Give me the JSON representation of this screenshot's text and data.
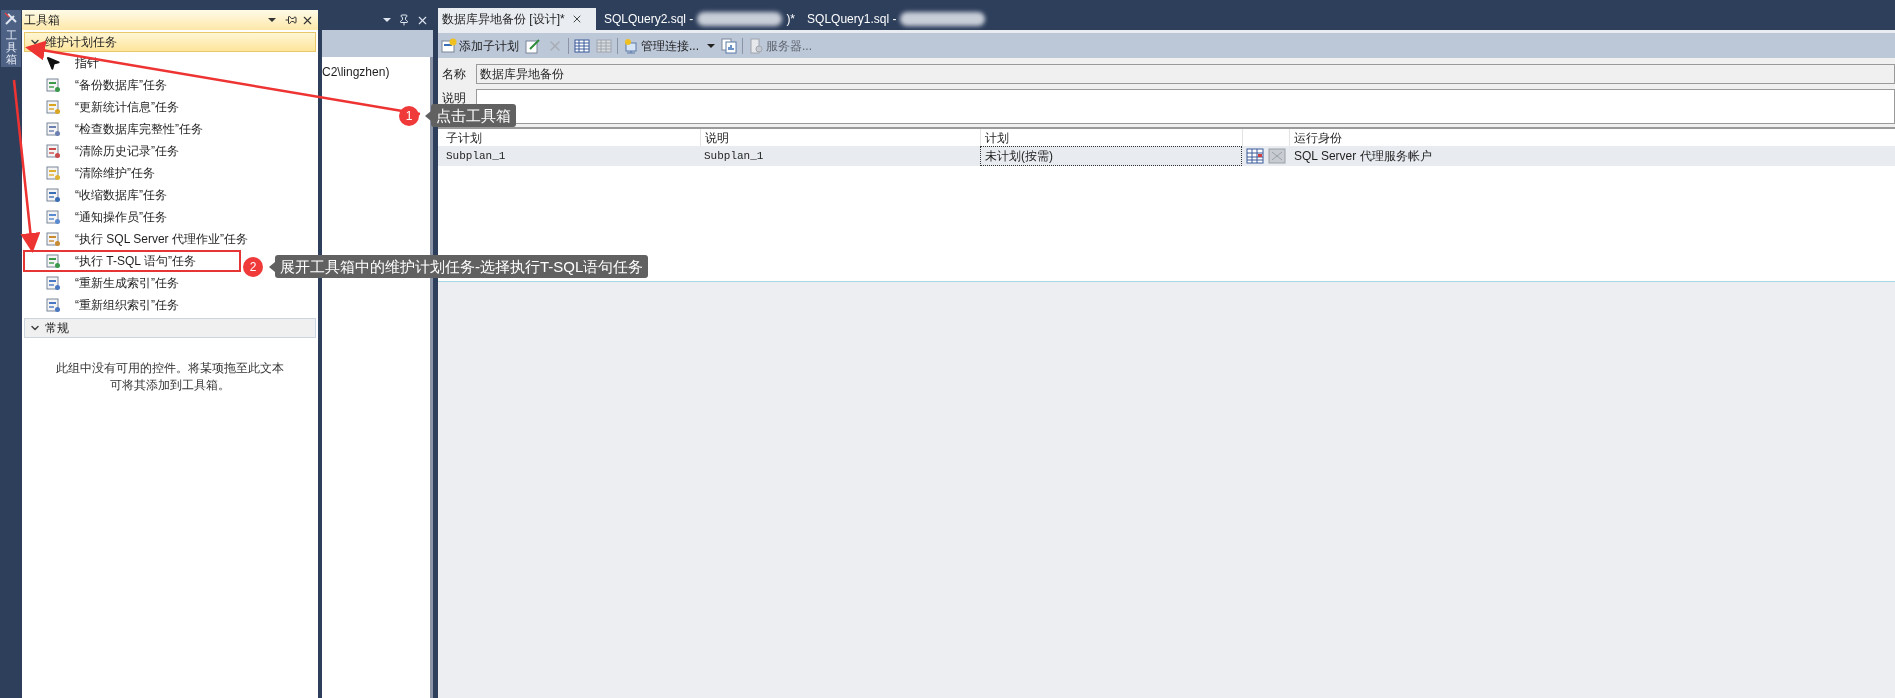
{
  "side_strip": {
    "label": "工具箱"
  },
  "toolbox": {
    "title": "工具箱",
    "groups": [
      {
        "title": "维护计划任务",
        "expanded": true,
        "active": true,
        "items": [
          {
            "label": "指针",
            "kind": "pointer",
            "highlighted": false
          },
          {
            "label": "“备份数据库”任务",
            "kind": "task",
            "highlighted": false
          },
          {
            "label": "“更新统计信息”任务",
            "kind": "task",
            "highlighted": false
          },
          {
            "label": "“检查数据库完整性”任务",
            "kind": "task",
            "highlighted": false
          },
          {
            "label": "“清除历史记录”任务",
            "kind": "task",
            "highlighted": false
          },
          {
            "label": "“清除维护”任务",
            "kind": "task",
            "highlighted": false
          },
          {
            "label": "“收缩数据库”任务",
            "kind": "task",
            "highlighted": false
          },
          {
            "label": "“通知操作员”任务",
            "kind": "task",
            "highlighted": false
          },
          {
            "label": "“执行 SQL Server 代理作业”任务",
            "kind": "task",
            "highlighted": false
          },
          {
            "label": "“执行 T-SQL 语句”任务",
            "kind": "task",
            "highlighted": true
          },
          {
            "label": "“重新生成索引”任务",
            "kind": "task",
            "highlighted": false
          },
          {
            "label": "“重新组织索引”任务",
            "kind": "task",
            "highlighted": false
          }
        ]
      },
      {
        "title": "常规",
        "expanded": true,
        "active": false,
        "empty_message": "此组中没有可用的控件。将某项拖至此文本可将其添加到工具箱。"
      }
    ]
  },
  "middle_panel": {
    "text": "C2\\lingzhen)"
  },
  "tabs": [
    {
      "label": "数据库异地备份 [设计]*",
      "selected": true,
      "redacted": false
    },
    {
      "label": "SQLQuery2.sql -",
      "selected": false,
      "redacted": true,
      "suffix": ")*"
    },
    {
      "label": "SQLQuery1.sql -",
      "selected": false,
      "redacted": true
    }
  ],
  "toolbar": [
    {
      "kind": "add",
      "label": "添加子计划",
      "disabled": false
    },
    {
      "kind": "edit",
      "disabled": false
    },
    {
      "kind": "delete",
      "disabled": true
    },
    {
      "kind": "separator"
    },
    {
      "kind": "grid",
      "disabled": false
    },
    {
      "kind": "grid",
      "disabled": true
    },
    {
      "kind": "separator"
    },
    {
      "kind": "connections",
      "label": "管理连接...",
      "disabled": false
    },
    {
      "kind": "report",
      "disabled": false
    },
    {
      "kind": "separator"
    },
    {
      "kind": "server",
      "label": "服务器...",
      "disabled": true
    }
  ],
  "form": {
    "name_label": "名称",
    "name_value": "数据库异地备份",
    "description_label": "说明"
  },
  "subplans": {
    "columns": [
      "子计划",
      "说明",
      "计划",
      "运行身份"
    ],
    "rows": [
      {
        "subplan": "Subplan_1",
        "description": "Subplan_1",
        "schedule": "未计划(按需)",
        "run_as": "SQL Server 代理服务帐户"
      }
    ]
  },
  "annotations": [
    {
      "number": "1",
      "text": "点击工具箱"
    },
    {
      "number": "2",
      "text": "展开工具箱中的维护计划任务-选择执行T-SQL语句任务"
    }
  ]
}
